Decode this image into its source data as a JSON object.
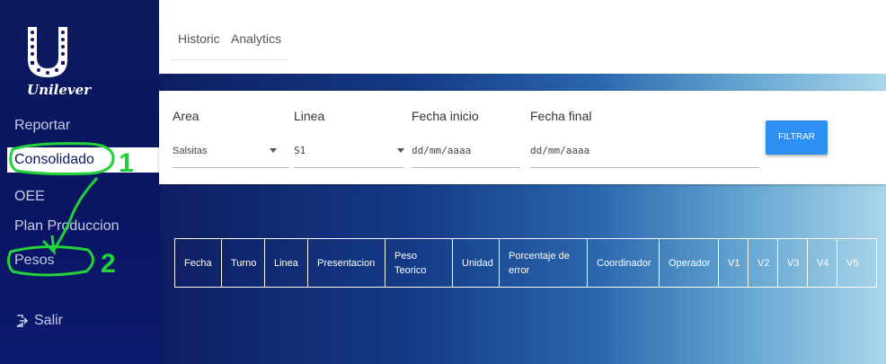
{
  "brand": {
    "name": "Unilever",
    "logo_icon": "unilever-logo-icon"
  },
  "sidebar": {
    "items": [
      {
        "label": "Reportar"
      },
      {
        "label": "Consolidado",
        "active": true
      },
      {
        "label": "OEE"
      },
      {
        "label": "Plan Produccion"
      },
      {
        "label": "Pesos"
      }
    ],
    "logout": {
      "label": "Salir",
      "icon": "logout-icon"
    }
  },
  "header": {
    "tabs": [
      "Historic",
      "Analytics"
    ]
  },
  "filters": {
    "area": {
      "label": "Area",
      "value": "Salsitas"
    },
    "linea": {
      "label": "Linea",
      "value": "S1"
    },
    "fecha_inicio": {
      "label": "Fecha inicio",
      "placeholder": "dd/mm/aaaa"
    },
    "fecha_final": {
      "label": "Fecha final",
      "placeholder": "dd/mm/aaaa"
    },
    "button": "FILTRAR"
  },
  "table": {
    "columns": [
      "Fecha",
      "Turno",
      "Linea",
      "Presentacion",
      "Peso Teorico",
      "Unidad",
      "Porcentaje de error",
      "Coordinador",
      "Operador",
      "V1",
      "V2",
      "V3",
      "V4",
      "V5"
    ]
  },
  "annotations": {
    "step1": "1",
    "step2": "2",
    "color": "#22d23b"
  },
  "colors": {
    "sidebar": "#0c1a5c",
    "button": "#2c8ff1",
    "active_bg": "#ffffff"
  }
}
